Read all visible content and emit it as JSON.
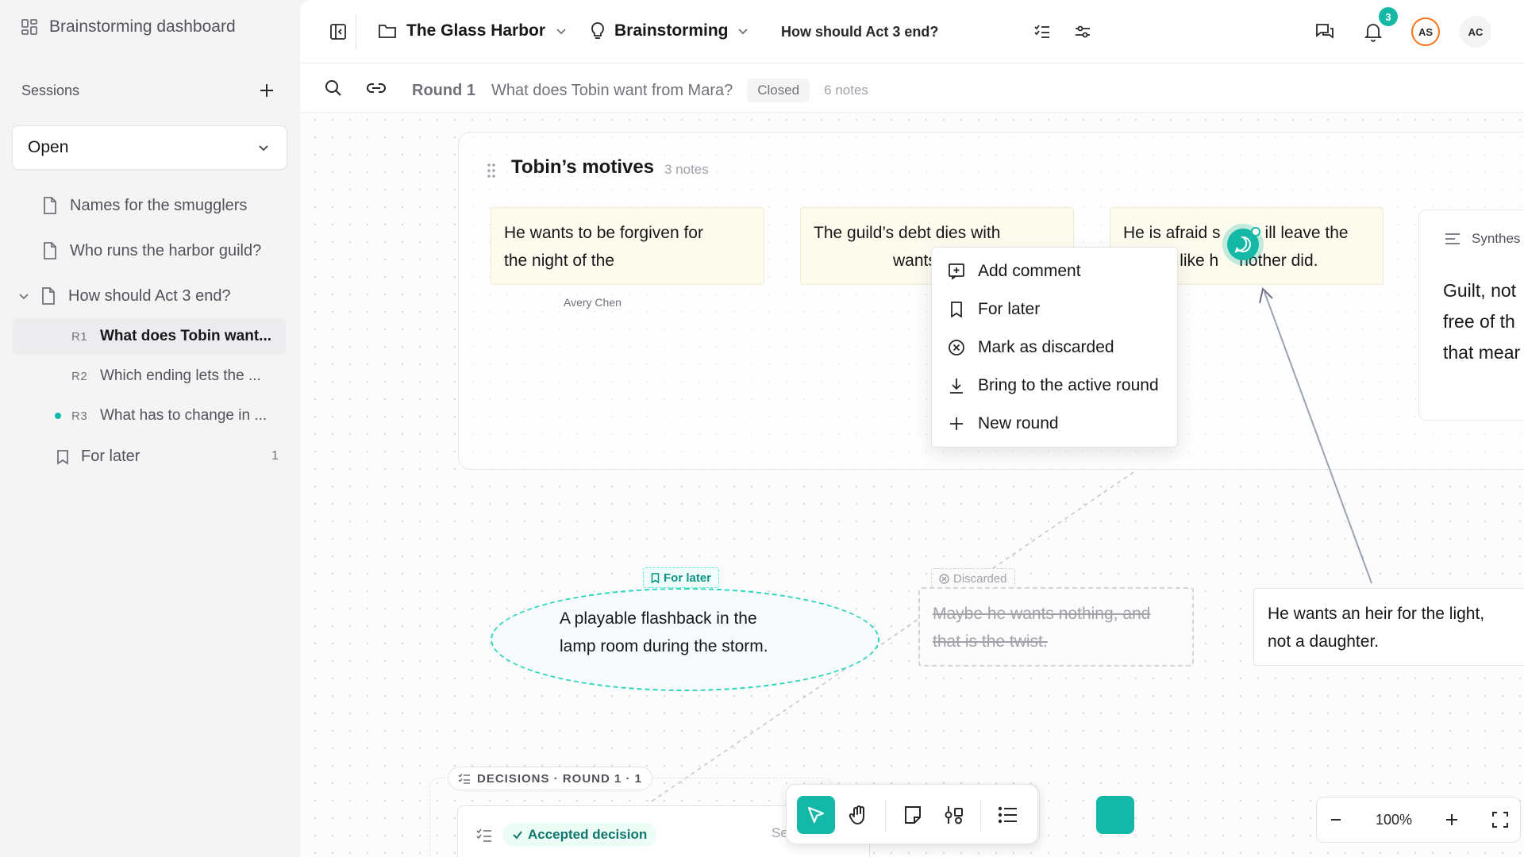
{
  "sidebar": {
    "title": "Brainstorming dashboard",
    "sessions_label": "Sessions",
    "filter_value": "Open",
    "items": [
      {
        "label": "Names for the smugglers"
      },
      {
        "label": "Who runs the harbor guild?"
      },
      {
        "label": "How should Act 3 end?"
      }
    ],
    "rounds": [
      {
        "tag": "R1",
        "label": "What does Tobin want..."
      },
      {
        "tag": "R2",
        "label": "Which ending lets the ..."
      },
      {
        "tag": "R3",
        "label": "What has to change in ..."
      }
    ],
    "for_later": {
      "label": "For later",
      "count": "1"
    }
  },
  "header": {
    "project": "The Glass Harbor",
    "mode": "Brainstorming",
    "question": "How should Act 3 end?",
    "notifications": "3",
    "avatars": [
      "AS",
      "AC"
    ]
  },
  "round": {
    "label": "Round 1",
    "question": "What does Tobin want from Mara?",
    "status": "Closed",
    "notes": "6 notes"
  },
  "group": {
    "title": "Tobin’s motives",
    "count": "3 notes",
    "notes": [
      {
        "line1": "He wants to be forgiven for",
        "line2": "the night of the"
      },
      {
        "line1": "The guild’s debt dies with",
        "line2": "wants her free of it."
      },
      {
        "line1": "He is afraid s",
        "line1b": "ill leave the",
        "line2a": "harbor, like h",
        "line2b": "nother did."
      }
    ],
    "author": "Avery Chen",
    "synthesis": {
      "label": "Synthes",
      "lines": [
        "Guilt, not",
        "free of th",
        "that mear"
      ]
    }
  },
  "context_menu": [
    {
      "label": "Add comment",
      "icon": "comment-plus-icon"
    },
    {
      "label": "For later",
      "icon": "bookmark-icon"
    },
    {
      "label": "Mark as discarded",
      "icon": "circle-x-icon"
    },
    {
      "label": "Bring to the active round",
      "icon": "arrow-down-tray-icon"
    },
    {
      "label": "New round",
      "icon": "plus-icon"
    }
  ],
  "floating": {
    "for_later_tag": "For later",
    "for_later_lines": [
      "A playable flashback in the",
      "lamp room during the storm."
    ],
    "discarded_tag": "Discarded",
    "discarded_lines": [
      "Maybe he wants nothing, and",
      "that is the twist."
    ],
    "heir_lines": [
      "He wants an heir for the light,",
      "not a daughter."
    ]
  },
  "decisions": {
    "label": "DECISIONS · ROUND 1 · 1",
    "accepted": "Accepted decision",
    "trailing": "Se"
  },
  "zoom": {
    "value": "100%"
  },
  "colors": {
    "accent": "#14b8a6",
    "notification_badge": "#14b8a6",
    "avatar_as_ring": "#f97316"
  }
}
